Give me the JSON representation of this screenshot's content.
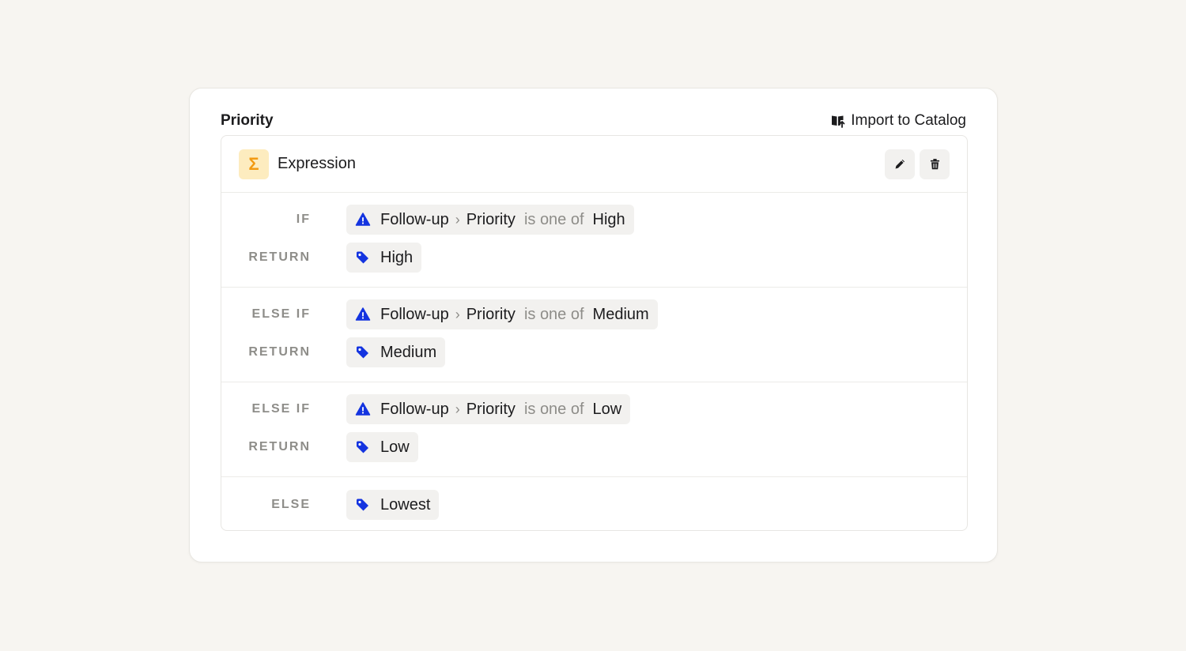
{
  "card": {
    "title": "Priority",
    "import_label": "Import to Catalog"
  },
  "expression": {
    "title": "Expression",
    "icon_glyph": "Σ"
  },
  "rules": [
    {
      "keyword": "IF",
      "condition": {
        "source": "Follow-up",
        "field": "Priority",
        "operator": "is one of",
        "value": "High"
      },
      "return_keyword": "RETURN",
      "return_value": "High"
    },
    {
      "keyword": "ELSE IF",
      "condition": {
        "source": "Follow-up",
        "field": "Priority",
        "operator": "is one of",
        "value": "Medium"
      },
      "return_keyword": "RETURN",
      "return_value": "Medium"
    },
    {
      "keyword": "ELSE IF",
      "condition": {
        "source": "Follow-up",
        "field": "Priority",
        "operator": "is one of",
        "value": "Low"
      },
      "return_keyword": "RETURN",
      "return_value": "Low"
    }
  ],
  "else_rule": {
    "keyword": "ELSE",
    "value": "Lowest"
  },
  "icons": {
    "import": "book-import-icon",
    "sigma": "sigma-icon",
    "edit": "pencil-icon",
    "delete": "trash-icon",
    "condition": "warning-triangle-icon",
    "value": "tag-icon",
    "separator": "chevron-right-icon"
  },
  "colors": {
    "accent": "#1434e0",
    "sigma_bg": "#fdecbf",
    "sigma_fg": "#f29a12",
    "page_bg": "#f7f5f1"
  }
}
